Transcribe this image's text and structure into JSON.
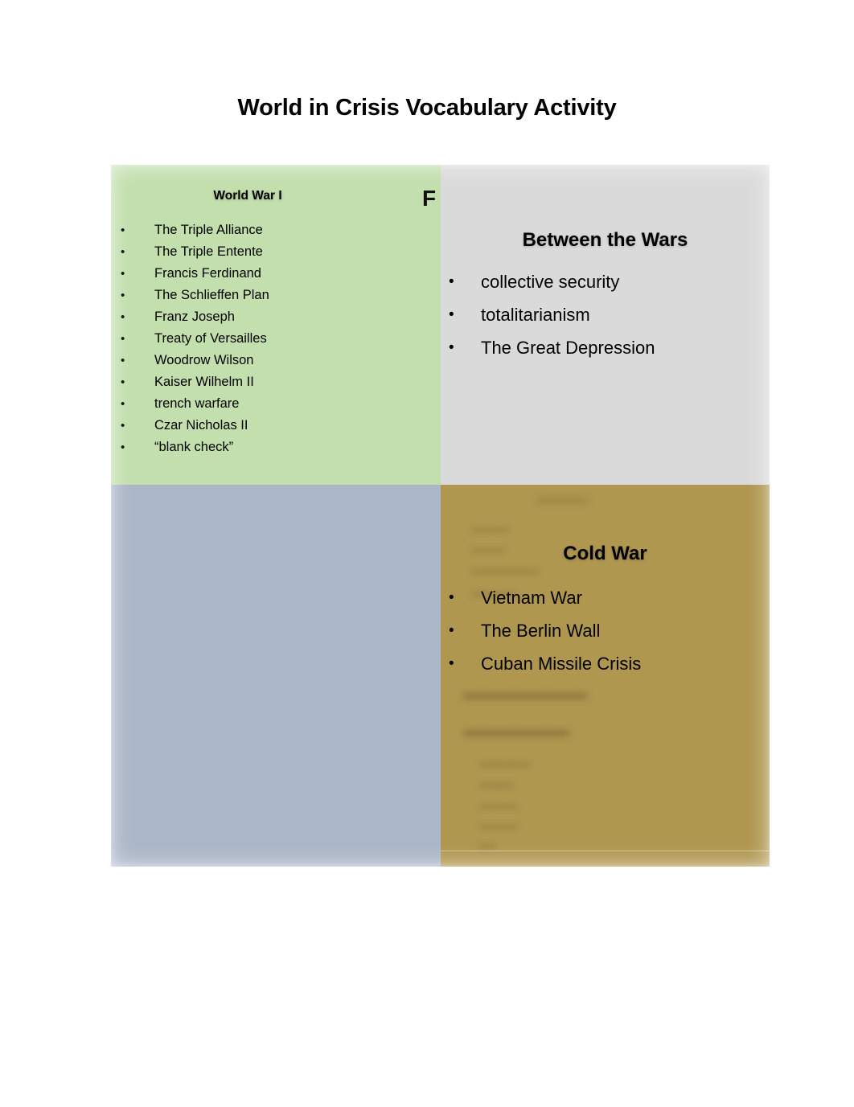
{
  "document": {
    "title": "World in Crisis Vocabulary Activity",
    "background_color": "#ffffff"
  },
  "quadrants": {
    "top_left": {
      "name": "World War I",
      "heading": "World War I",
      "fill_color": "#c3dfad",
      "stray_glyph": "F",
      "items": [
        "The Triple Alliance",
        "The Triple Entente",
        "Francis Ferdinand",
        "The Schlieffen Plan",
        "Franz Joseph",
        "Treaty of Versailles",
        "Woodrow Wilson",
        "Kaiser Wilhelm II",
        "trench warfare",
        "Czar Nicholas II",
        "“blank check”"
      ]
    },
    "top_right": {
      "name": "Between the Wars",
      "heading": "Between the Wars",
      "fill_color": "#dadada",
      "items": [
        "collective security",
        "totalitarianism",
        "The Great Depression"
      ]
    },
    "bottom_left": {
      "name": "empty quadrant",
      "heading": "",
      "fill_color": "#abb6c7",
      "items": []
    },
    "bottom_right": {
      "name": "Cold War",
      "heading": "Cold War",
      "fill_color": "#b09750",
      "items": [
        "Vietnam War",
        "The Berlin Wall",
        "Cuban Missile Crisis"
      ],
      "ghost_text": {
        "note": "illegible blurred underlying text",
        "lines": [
          "••••••••••••",
          "•••••••••",
          "••••••••",
          "••••••••••••••••",
          "•••••••••••",
          "•••••••••••••••••••••",
          "••••••••••••••••••",
          "••••••••••••",
          "••••••••",
          "•••••••••",
          "•••••••••",
          "••••"
        ]
      }
    }
  },
  "bullet_marker": "•"
}
